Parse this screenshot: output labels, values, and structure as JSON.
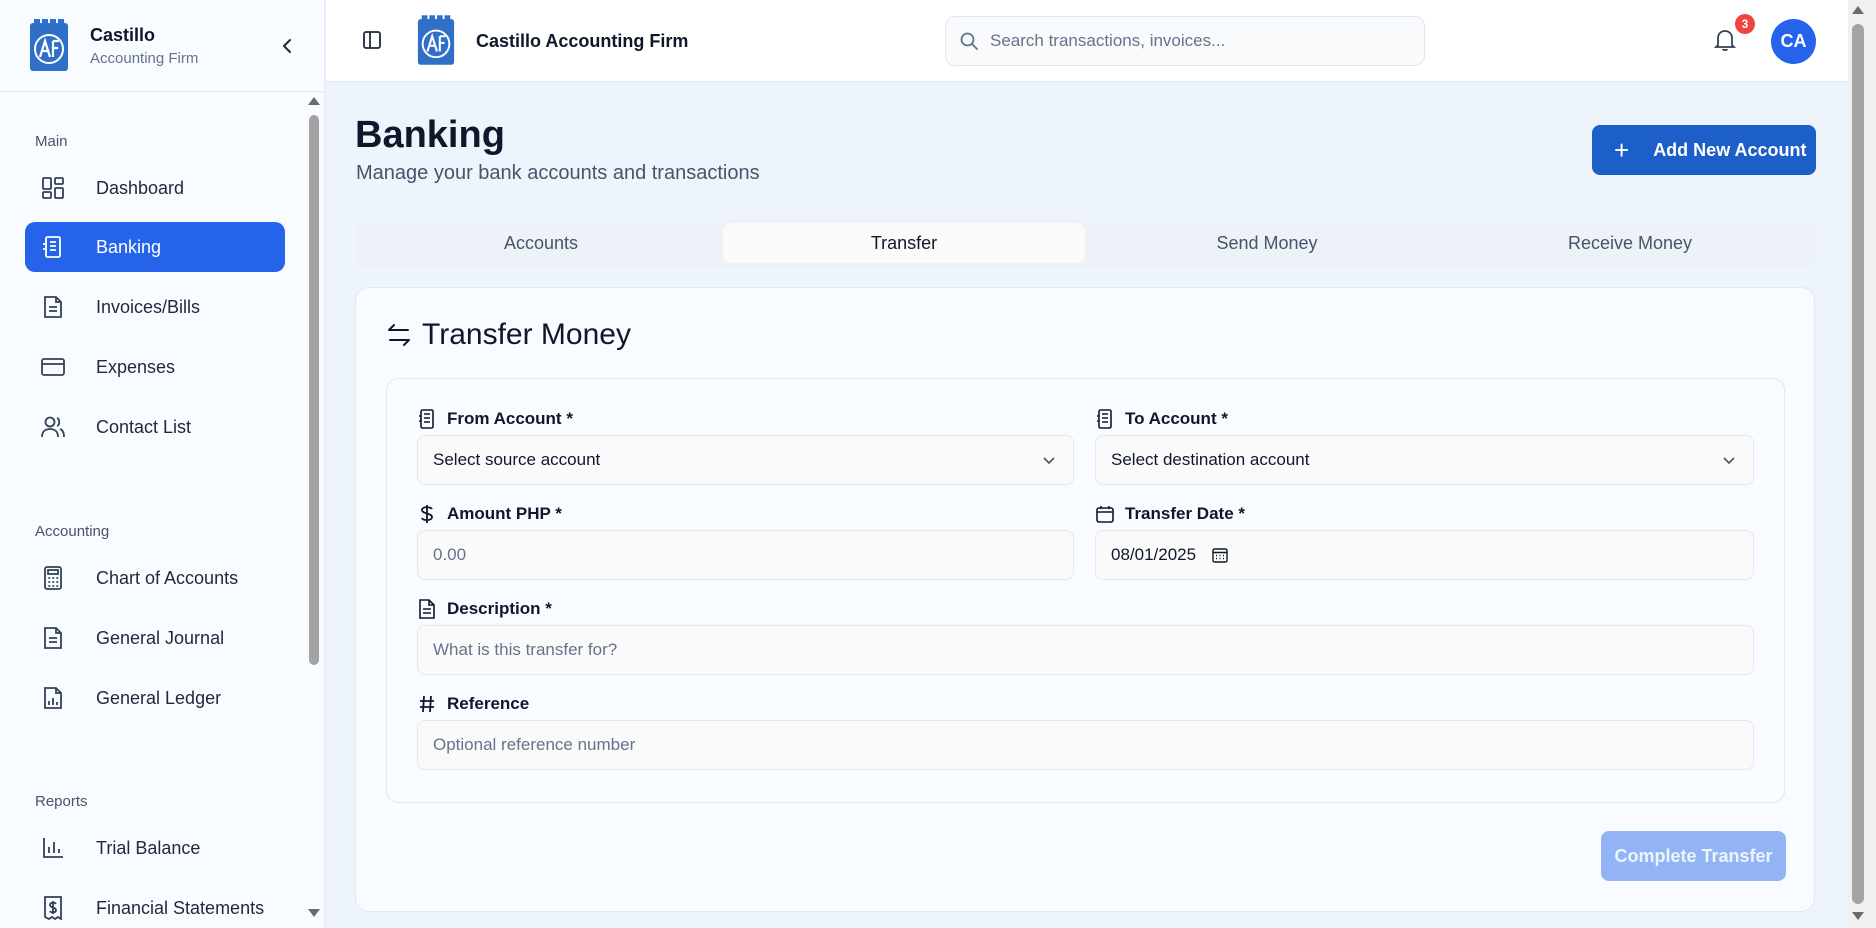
{
  "sidebar": {
    "brand_name": "Castillo",
    "brand_sub": "Accounting Firm",
    "sections": {
      "main": "Main",
      "accounting": "Accounting",
      "reports": "Reports"
    },
    "items": [
      {
        "label": "Dashboard",
        "icon": "dashboard-icon"
      },
      {
        "label": "Banking",
        "icon": "bank-icon",
        "active": true
      },
      {
        "label": "Invoices/Bills",
        "icon": "document-icon"
      },
      {
        "label": "Expenses",
        "icon": "credit-card-icon"
      },
      {
        "label": "Contact List",
        "icon": "users-icon"
      },
      {
        "label": "Chart of Accounts",
        "icon": "calculator-icon"
      },
      {
        "label": "General Journal",
        "icon": "document-icon"
      },
      {
        "label": "General Ledger",
        "icon": "file-chart-icon"
      },
      {
        "label": "Trial Balance",
        "icon": "bar-chart-icon"
      },
      {
        "label": "Financial Statements",
        "icon": "receipt-icon"
      }
    ]
  },
  "header": {
    "title": "Castillo Accounting Firm",
    "search_placeholder": "Search transactions, invoices...",
    "notification_count": "3",
    "avatar_initials": "CA"
  },
  "main": {
    "title": "Banking",
    "subtitle": "Manage your bank accounts and transactions",
    "add_button": "Add New Account",
    "tabs": [
      {
        "label": "Accounts"
      },
      {
        "label": "Transfer",
        "active": true
      },
      {
        "label": "Send Money"
      },
      {
        "label": "Receive Money"
      }
    ]
  },
  "transfer": {
    "title": "Transfer Money",
    "from_label": "From Account *",
    "from_value": "Select source account",
    "to_label": "To Account *",
    "to_value": "Select destination account",
    "amount_label": "Amount PHP *",
    "amount_placeholder": "0.00",
    "date_label": "Transfer Date *",
    "date_value": "08/01/2025",
    "description_label": "Description *",
    "description_placeholder": "What is this transfer for?",
    "reference_label": "Reference",
    "reference_placeholder": "Optional reference number",
    "submit": "Complete Transfer"
  },
  "colors": {
    "accent": "#2563eb",
    "button": "#1d5fc9",
    "disabled_button": "#93b4f4",
    "badge": "#ef4444"
  }
}
